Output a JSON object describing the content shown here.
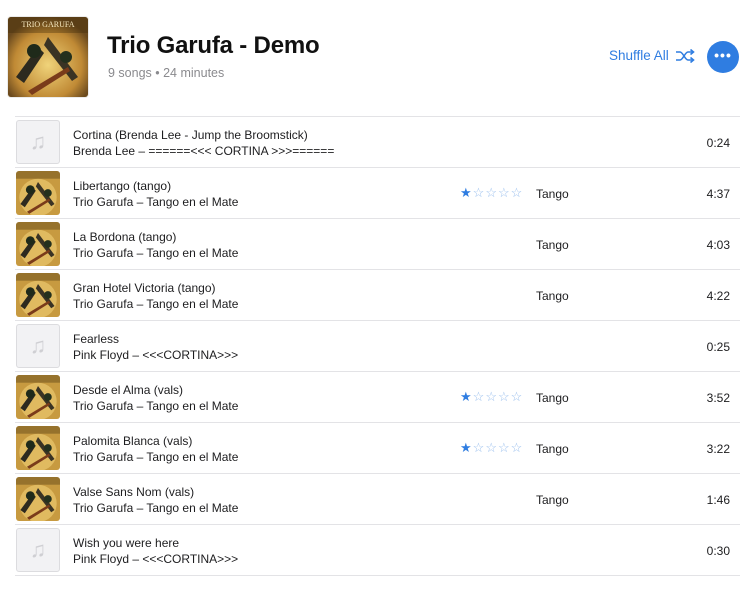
{
  "header": {
    "cover_text": "TRIO GARUFA",
    "title": "Trio Garufa - Demo",
    "subtitle": "9 songs • 24 minutes",
    "shuffle_label": "Shuffle All",
    "more_label": "•••"
  },
  "colors": {
    "accent": "#2f7de1",
    "secondary_text": "#8a8a8e",
    "divider": "#e3e3e6"
  },
  "songs": [
    {
      "title": "Cortina (Brenda Lee - Jump the Broomstick)",
      "subtitle": "Brenda Lee – ======<<< CORTINA >>>======",
      "rating": 0,
      "genre": "",
      "duration": "0:24",
      "artwork": "placeholder"
    },
    {
      "title": "Libertango (tango)",
      "subtitle": "Trio Garufa – Tango en el Mate",
      "rating": 1,
      "genre": "Tango",
      "duration": "4:37",
      "artwork": "album"
    },
    {
      "title": "La Bordona (tango)",
      "subtitle": "Trio Garufa – Tango en el Mate",
      "rating": 0,
      "genre": "Tango",
      "duration": "4:03",
      "artwork": "album"
    },
    {
      "title": "Gran Hotel Victoria (tango)",
      "subtitle": "Trio Garufa – Tango en el Mate",
      "rating": 0,
      "genre": "Tango",
      "duration": "4:22",
      "artwork": "album"
    },
    {
      "title": "Fearless",
      "subtitle": "Pink Floyd – <<<CORTINA>>>",
      "rating": 0,
      "genre": "",
      "duration": "0:25",
      "artwork": "placeholder"
    },
    {
      "title": "Desde el Alma (vals)",
      "subtitle": "Trio Garufa – Tango en el Mate",
      "rating": 1,
      "genre": "Tango",
      "duration": "3:52",
      "artwork": "album"
    },
    {
      "title": "Palomita Blanca (vals)",
      "subtitle": "Trio Garufa – Tango en el Mate",
      "rating": 1,
      "genre": "Tango",
      "duration": "3:22",
      "artwork": "album"
    },
    {
      "title": "Valse Sans Nom (vals)",
      "subtitle": "Trio Garufa – Tango en el Mate",
      "rating": 0,
      "genre": "Tango",
      "duration": "1:46",
      "artwork": "album"
    },
    {
      "title": "Wish you were here",
      "subtitle": "Pink Floyd – <<<CORTINA>>>",
      "rating": 0,
      "genre": "",
      "duration": "0:30",
      "artwork": "placeholder"
    }
  ]
}
